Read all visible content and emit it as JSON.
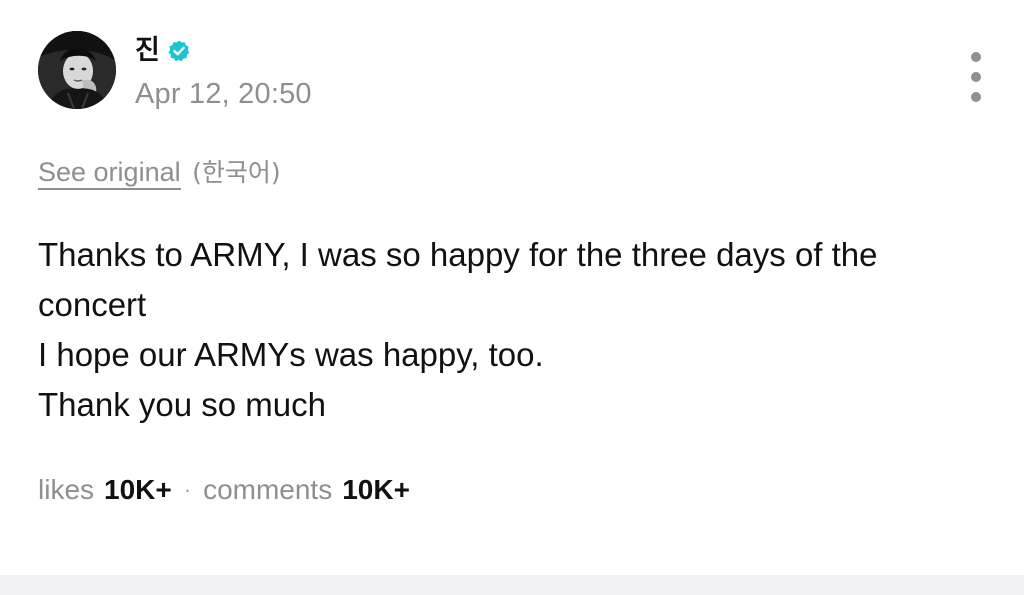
{
  "post": {
    "author": "진",
    "verified": true,
    "timestamp": "Apr 12, 20:50",
    "see_original_label": "See original",
    "original_language": "(한국어)",
    "body_lines": [
      "Thanks to ARMY, I was so happy for the three days of the",
      "concert",
      "I hope our ARMYs was happy, too.",
      "Thank you so much"
    ],
    "stats": {
      "likes_label": "likes",
      "likes_value": "10K+",
      "separator": "·",
      "comments_label": "comments",
      "comments_value": "10K+"
    }
  },
  "icons": {
    "verified": "verified-badge-icon",
    "more": "more-vertical-icon",
    "avatar": "profile-photo"
  },
  "colors": {
    "verified_badge": "#19c6d0",
    "muted_text": "#8e8e93",
    "primary_text": "#111111",
    "footer_band": "#f2f2f4"
  }
}
